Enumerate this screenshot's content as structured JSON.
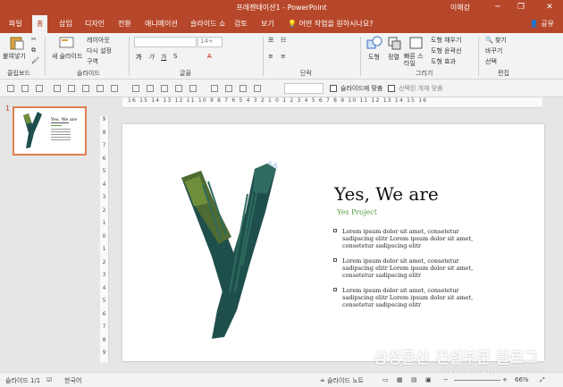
{
  "window": {
    "title": "프레젠테이션1 - PowerPoint",
    "user": "이해강",
    "minimize": "─",
    "restore": "❐",
    "close": "✕"
  },
  "tabs": [
    {
      "label": "파일"
    },
    {
      "label": "홈"
    },
    {
      "label": "삽입"
    },
    {
      "label": "디자인"
    },
    {
      "label": "전환"
    },
    {
      "label": "애니메이션"
    },
    {
      "label": "슬라이드 쇼"
    },
    {
      "label": "검토"
    },
    {
      "label": "보기"
    }
  ],
  "tellme": "어떤 작업을 원하시나요?",
  "share": "공유",
  "ribbon": {
    "clipboard": {
      "label": "클립보드",
      "paste": "붙여넣기"
    },
    "slides": {
      "label": "슬라이드",
      "new_slide": "새 슬라이드",
      "layout": "레이아웃",
      "reset": "다시 설정",
      "section": "구역"
    },
    "font": {
      "label": "글꼴",
      "font_size": "14+"
    },
    "paragraph": {
      "label": "단락"
    },
    "drawing": {
      "label": "그리기",
      "shapes": "도형",
      "arrange": "정렬",
      "quick_styles": "빠른 스타일",
      "fill": "도형 채우기",
      "outline": "도형 윤곽선",
      "effects": "도형 효과"
    },
    "editing": {
      "label": "편집",
      "find": "찾기",
      "replace": "바꾸기",
      "select": "선택"
    }
  },
  "quickbar": {
    "fit_slide": "슬라이드에 맞춤",
    "select_objects": "선택된 개체 맞춤"
  },
  "thumbnail": {
    "number": "1",
    "title": "Yes, We are"
  },
  "ruler": {
    "h_ticks": "16 15 14 13 12 11 10 9 8 7 6 5 4 3 2 1 0 1 2 3 4 5 6 7 8 9 10 11 12 13 14 15 16",
    "v_ticks": [
      "9",
      "8",
      "7",
      "6",
      "5",
      "4",
      "3",
      "2",
      "1",
      "0",
      "1",
      "2",
      "3",
      "4",
      "5",
      "6",
      "7",
      "8",
      "9"
    ]
  },
  "slide": {
    "title": "Yes, We are",
    "subtitle": "Yes Project",
    "bullets": [
      "Lorem ipsum dolor sit amet, consetetur sadipscing elitr Lorem ipsum dolor sit amet, consetetur sadipscing elitr",
      "Lorem ipsum dolor sit amet, consetetur sadipscing elitr Lorem ipsum dolor sit amet, consetetur sadipscing elitr",
      "Lorem ipsum dolor sit amet, consetetur sadipscing elitr Lorem ipsum dolor sit amet, consetetur sadipscing elitr"
    ]
  },
  "status": {
    "slide_count": "슬라이드 1/1",
    "language": "한국어",
    "notes": "슬라이드 노트",
    "zoom": "66%"
  },
  "watermark": {
    "line1": "삼성물산 건설부문 블로그",
    "line2": "www.samsungblueprint.com"
  },
  "colors": {
    "accent": "#b7472a",
    "subtitle": "#5aa046",
    "y_dark": "#1e4f4c",
    "y_light": "#6f8f3a"
  }
}
